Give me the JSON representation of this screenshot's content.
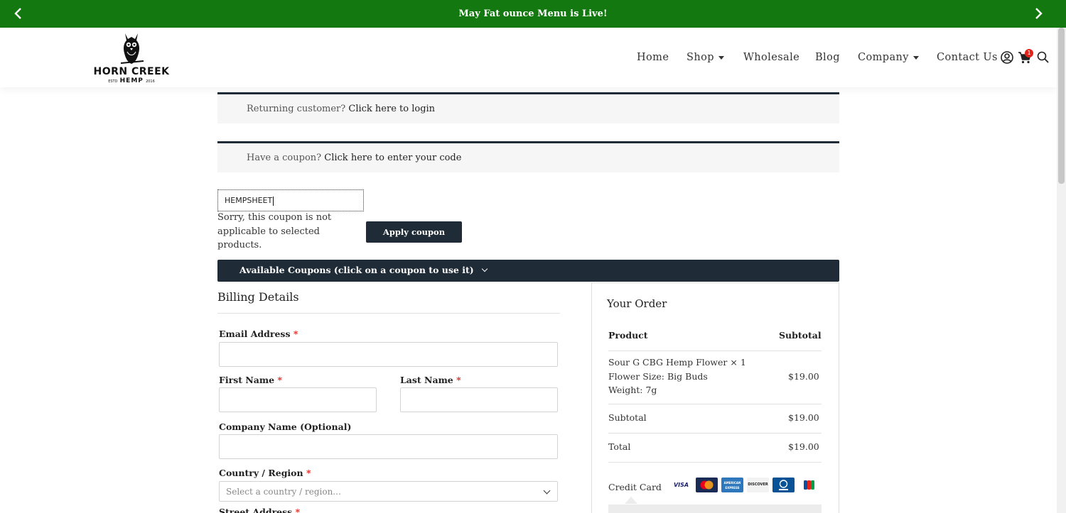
{
  "announcement": {
    "text": "May Fat ounce Menu is Live!"
  },
  "logo": {
    "brand": "HORN CREEK",
    "sub_left": "ESTD",
    "sub_middle": "HEMP",
    "sub_right": "2016"
  },
  "nav": {
    "home": "Home",
    "shop": "Shop",
    "wholesale": "Wholesale",
    "blog": "Blog",
    "company": "Company",
    "contact": "Contact Us",
    "cart_count": "1"
  },
  "notices": {
    "login_prompt": "Returning customer?",
    "login_link": "Click here to login",
    "coupon_prompt": "Have a coupon?",
    "coupon_link": "Click here to enter your code"
  },
  "coupon": {
    "value": "HEMPSHEET",
    "error": "Sorry, this coupon is not applicable to selected products.",
    "apply_label": "Apply coupon",
    "available_label": "Available Coupons (click on a coupon to use it)"
  },
  "billing": {
    "title": "Billing Details",
    "email_label": "Email Address",
    "first_name_label": "First Name",
    "last_name_label": "Last Name",
    "company_label": "Company Name (Optional)",
    "country_label": "Country / Region",
    "country_placeholder": "Select a country / region...",
    "street_label": "Street Address",
    "required_mark": "*"
  },
  "order": {
    "title": "Your Order",
    "col_product": "Product",
    "col_subtotal": "Subtotal",
    "item_name": "Sour G CBG Hemp Flower",
    "item_qty": "× 1",
    "item_meta_1": "Flower Size: Big Buds",
    "item_meta_2": "Weight: 7g",
    "item_price": "$19.00",
    "subtotal_label": "Subtotal",
    "subtotal_value": "$19.00",
    "total_label": "Total",
    "total_value": "$19.00",
    "payment_label": "Credit Card",
    "card_brands": [
      "VISA",
      "Mastercard",
      "AMERICAN EXPRESS",
      "DISCOVER",
      "Diners Club",
      "JCB"
    ]
  },
  "colors": {
    "announcement_bg": "#13780f",
    "dark_button": "#1f2b36",
    "required": "#e2231a"
  }
}
